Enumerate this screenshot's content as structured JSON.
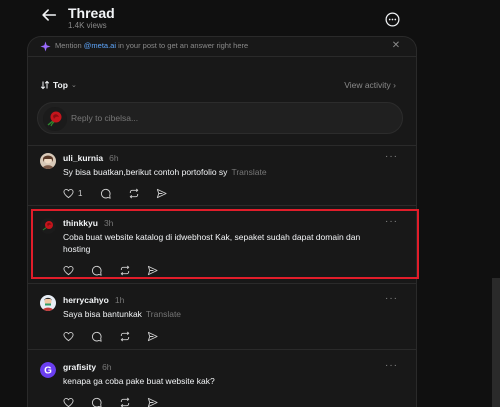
{
  "header": {
    "title": "Thread",
    "views": "1.4K views"
  },
  "mention_bar": {
    "prefix": "Mention ",
    "handle": "@meta.ai",
    "suffix": " in your post to get an answer right here"
  },
  "sort": {
    "label": "Top",
    "view_activity": "View activity"
  },
  "reply": {
    "placeholder": "Reply to cibelsa..."
  },
  "posts": [
    {
      "username": "uli_kurnia",
      "time": "6h",
      "text": "Sy bisa buatkan,berikut contoh portofolio sy",
      "translate": "Translate",
      "likes": "1"
    },
    {
      "username": "thinkkyu",
      "time": "3h",
      "text": "Coba buat website katalog di idwebhost Kak, sepaket sudah dapat domain dan hosting",
      "translate": "",
      "likes": ""
    },
    {
      "username": "herrycahyo",
      "time": "1h",
      "text": "Saya bisa bantunkak",
      "translate": "Translate",
      "likes": ""
    },
    {
      "username": "grafisity",
      "time": "6h",
      "text": "kenapa ga coba pake buat website kak?",
      "translate": "",
      "likes": ""
    }
  ],
  "colors": {
    "background": "#101010",
    "panel": "#181818",
    "highlight": "#e11d2a",
    "link": "#5fa8ff"
  }
}
